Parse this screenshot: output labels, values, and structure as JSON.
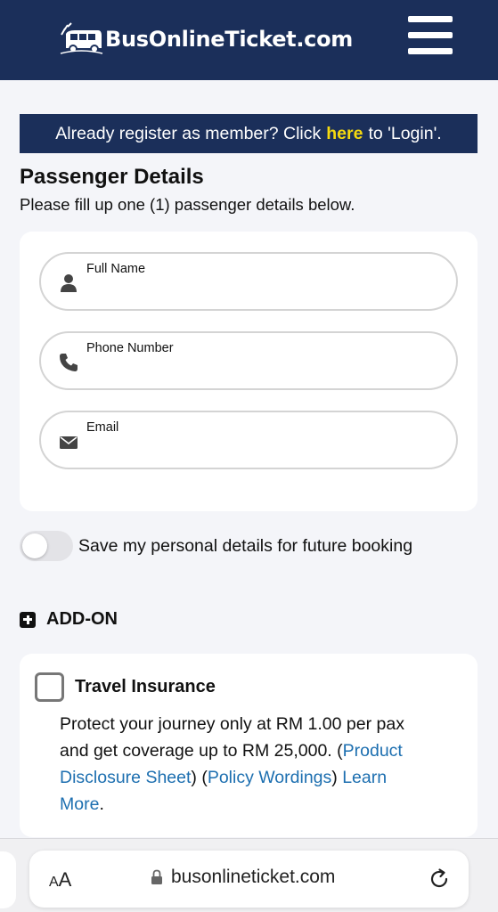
{
  "header": {
    "logo_text": "BusOnlineTicket.com",
    "menu_icon": "hamburger-menu-icon",
    "background": "#1b2f5a"
  },
  "login_banner": {
    "prefix": "Already register as member? Click",
    "link": "here",
    "suffix": "to 'Login'.",
    "link_color": "#f5d90f"
  },
  "passenger": {
    "title": "Passenger Details",
    "subtitle": "Please fill up one (1) passenger details below.",
    "fields": [
      {
        "label": "Full Name",
        "icon": "person-icon",
        "value": ""
      },
      {
        "label": "Phone Number",
        "icon": "phone-icon",
        "value": ""
      },
      {
        "label": "Email",
        "icon": "envelope-icon",
        "value": ""
      }
    ]
  },
  "save_toggle": {
    "label": "Save my personal details for future booking",
    "checked": false
  },
  "addon": {
    "title": "ADD-ON",
    "icon": "plus-square-icon"
  },
  "insurance": {
    "title": "Travel Insurance",
    "checked": false,
    "desc_text": "Protect your journey only at RM 1.00 per pax and get coverage up to RM 25,000.",
    "link_pds": "Product Disclosure Sheet",
    "link_policy": "Policy Wordings",
    "link_learn": "Learn More",
    "link_color": "#1d6fb0"
  },
  "browser": {
    "text_size_label": "AA",
    "url": "busonlineticket.com",
    "lock_icon": "lock-icon",
    "reload_icon": "reload-icon"
  }
}
